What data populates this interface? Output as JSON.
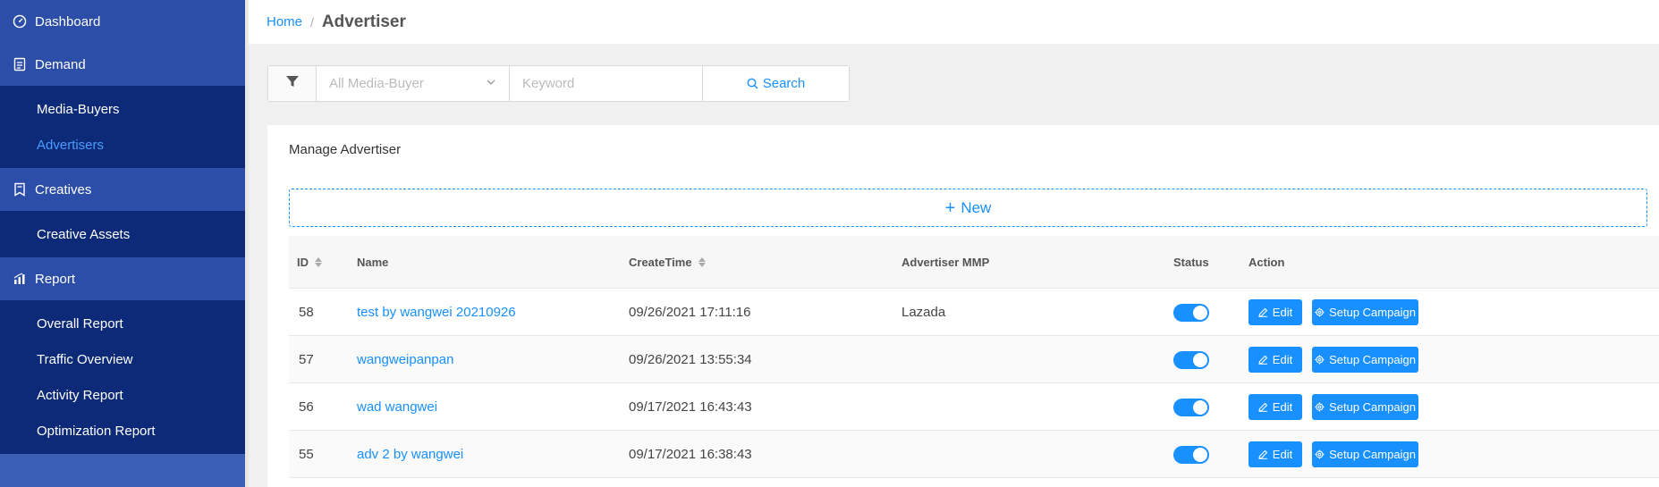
{
  "sidebar": {
    "sections": [
      {
        "label": "Dashboard",
        "icon": "dashboard-icon",
        "items": []
      },
      {
        "label": "Demand",
        "icon": "demand-icon",
        "items": [
          {
            "label": "Media-Buyers",
            "active": false
          },
          {
            "label": "Advertisers",
            "active": true
          }
        ]
      },
      {
        "label": "Creatives",
        "icon": "creatives-icon",
        "items": [
          {
            "label": "Creative Assets",
            "active": false
          }
        ]
      },
      {
        "label": "Report",
        "icon": "report-icon",
        "items": [
          {
            "label": "Overall Report",
            "active": false
          },
          {
            "label": "Traffic Overview",
            "active": false
          },
          {
            "label": "Activity Report",
            "active": false
          },
          {
            "label": "Optimization Report",
            "active": false
          }
        ]
      }
    ]
  },
  "header": {
    "breadcrumb_home": "Home",
    "breadcrumb_sep": "/",
    "title": "Advertiser"
  },
  "filter": {
    "media_buyer_placeholder": "All Media-Buyer",
    "keyword_placeholder": "Keyword",
    "search_label": "Search"
  },
  "card": {
    "title": "Manage Advertiser",
    "new_label": "New",
    "columns": [
      "ID",
      "Name",
      "CreateTime",
      "Advertiser MMP",
      "Status",
      "Action"
    ],
    "rows": [
      {
        "id": "58",
        "name": "test by wangwei 20210926",
        "create_time": "09/26/2021 17:11:16",
        "mmp": "Lazada",
        "status_on": true
      },
      {
        "id": "57",
        "name": "wangweipanpan",
        "create_time": "09/26/2021 13:55:34",
        "mmp": "",
        "status_on": true
      },
      {
        "id": "56",
        "name": "wad wangwei",
        "create_time": "09/17/2021 16:43:43",
        "mmp": "",
        "status_on": true
      },
      {
        "id": "55",
        "name": "adv 2 by wangwei",
        "create_time": "09/17/2021 16:38:43",
        "mmp": "",
        "status_on": true
      }
    ],
    "edit_label": "Edit",
    "setup_label": "Setup Campaign"
  },
  "colors": {
    "accent": "#1890ff",
    "sidebar_bg": "#3b5fb5",
    "sidebar_section": "#2c4ea8",
    "sidebar_sub": "#0d2a78"
  }
}
